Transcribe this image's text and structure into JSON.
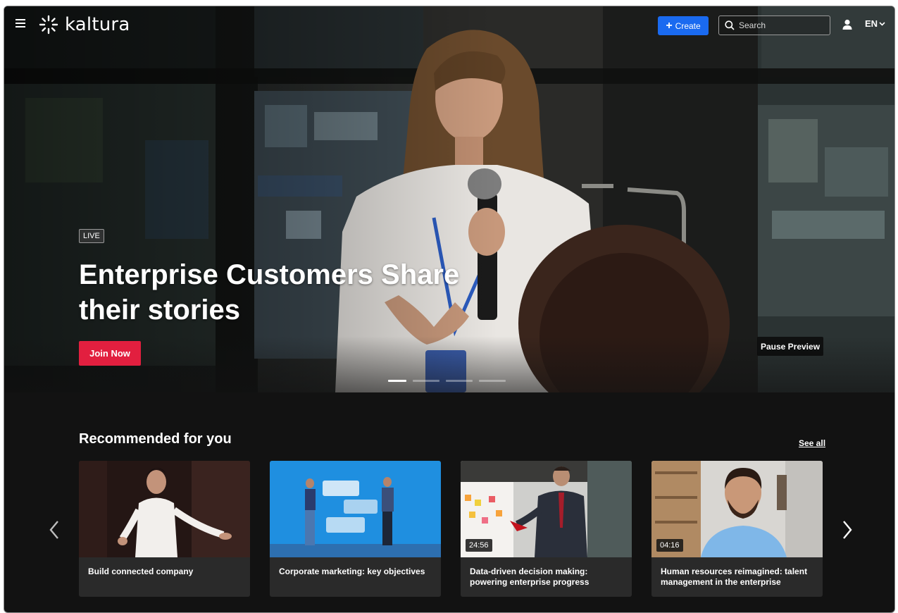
{
  "header": {
    "logo_text": "kaltura",
    "create_label": "Create",
    "search_placeholder": "Search",
    "language": "EN"
  },
  "hero": {
    "badge": "LIVE",
    "title": "Enterprise Customers Share their stories",
    "cta_label": "Join Now",
    "pause_label": "Pause Preview",
    "slides_count": 4,
    "active_slide": 1
  },
  "recommended": {
    "title": "Recommended for you",
    "see_all": "See all",
    "items": [
      {
        "title": "Build connected company",
        "duration": ""
      },
      {
        "title": "Corporate marketing: key objectives",
        "duration": ""
      },
      {
        "title": "Data-driven decision making: powering enterprise progress",
        "duration": "24:56"
      },
      {
        "title": "Human resources reimagined: talent management in the enterprise",
        "duration": "04:16"
      }
    ]
  },
  "colors": {
    "accent": "#1a6af0",
    "cta": "#e21f3f",
    "background": "#121212"
  }
}
